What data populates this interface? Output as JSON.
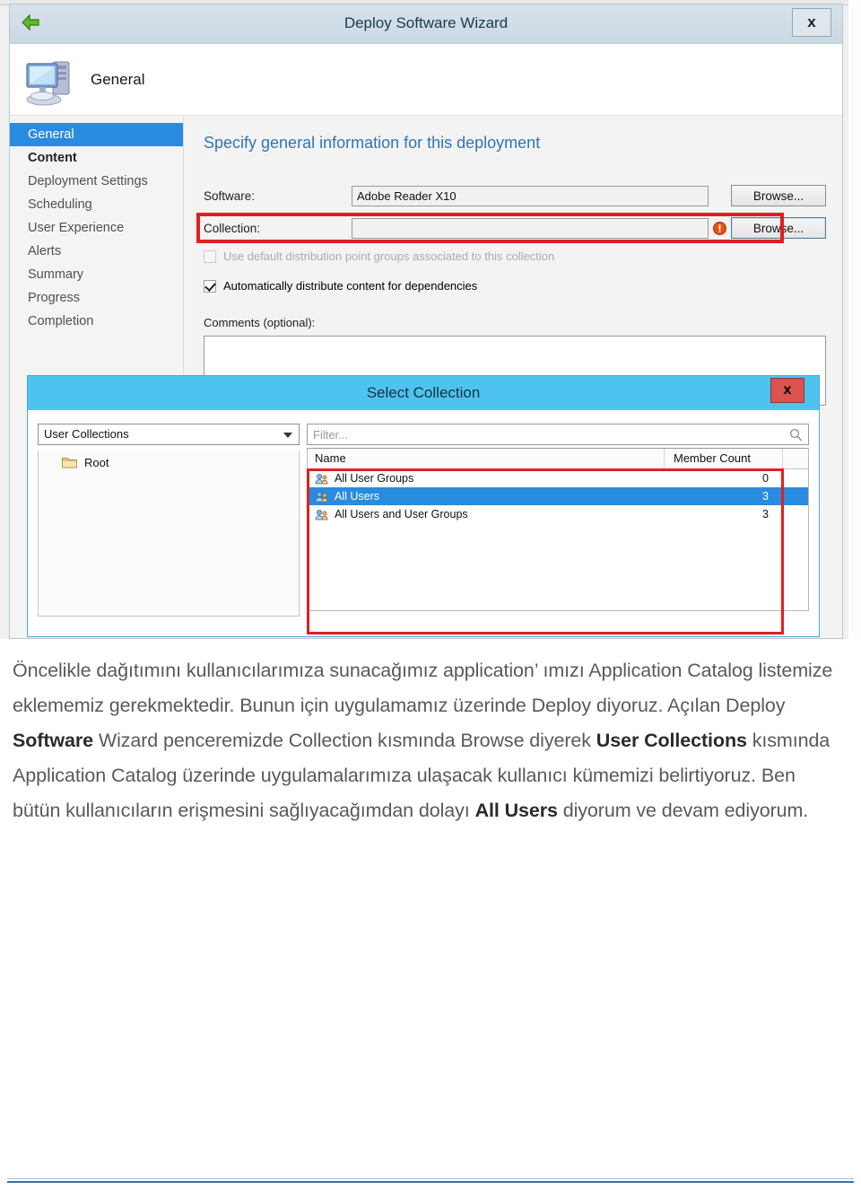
{
  "wizard": {
    "title": "Deploy Software Wizard",
    "close_label": "x",
    "header_label": "General",
    "content_heading": "Specify general information for this deployment",
    "icons": {
      "back_arrow": "green-arrow-icon",
      "computer": "computer-icon"
    },
    "sidebar": {
      "items": [
        {
          "label": "General",
          "state": "active"
        },
        {
          "label": "Content",
          "state": "visited"
        },
        {
          "label": "Deployment Settings",
          "state": "normal"
        },
        {
          "label": "Scheduling",
          "state": "normal"
        },
        {
          "label": "User Experience",
          "state": "normal"
        },
        {
          "label": "Alerts",
          "state": "normal"
        },
        {
          "label": "Summary",
          "state": "normal"
        },
        {
          "label": "Progress",
          "state": "normal"
        },
        {
          "label": "Completion",
          "state": "normal"
        }
      ]
    },
    "form": {
      "software_label": "Software:",
      "software_value": "Adobe Reader X10",
      "software_browse": "Browse...",
      "collection_label": "Collection:",
      "collection_value": "",
      "collection_browse": "Browse...",
      "collection_warning_icon": "warning-icon",
      "checkbox_default_dp": {
        "label": "Use default distribution point groups associated to this collection",
        "checked": false,
        "enabled": false
      },
      "checkbox_auto_distribute": {
        "label": "Automatically distribute content for dependencies",
        "checked": true,
        "enabled": true
      },
      "comments_label": "Comments (optional):",
      "comments_value": ""
    }
  },
  "modal": {
    "title": "Select Collection",
    "close_label": "x",
    "collection_type_selected": "User Collections",
    "tree_root_label": "Root",
    "filter_placeholder": "Filter...",
    "filter_value": "",
    "columns": [
      "Name",
      "Member Count"
    ],
    "rows": [
      {
        "name": "All User Groups",
        "count": "0",
        "selected": false
      },
      {
        "name": "All Users",
        "count": "3",
        "selected": true
      },
      {
        "name": "All Users and User Groups",
        "count": "3",
        "selected": false
      }
    ]
  },
  "caption": {
    "p1_a": "Öncelikle dağıtımını kullanıcılarımıza sunacağımız application’ ımızı Application Catalog listemize eklememiz gerekmektedir. Bunun için uygulamamız üzerinde Deploy diyoruz. Açılan Deploy ",
    "p1_b": "Software",
    "p1_c": " Wizard penceremizde Collection kısmında Browse diyerek ",
    "p1_d": "User Collections",
    "p1_e": " kısmında Application Catalog üzerinde uygulamalarımıza ulaşacak kullanıcı kümemizi belirtiyoruz. Ben bütün kullanıcıların erişmesini sağlıyacağımdan dolayı ",
    "p1_f": "All Users",
    "p1_g": " diyorum ve devam ediyorum."
  },
  "colors": {
    "accent_blue": "#2a8ce0",
    "modal_title_bar": "#4ec3ef",
    "highlight_red": "#e02020",
    "heading_blue": "#2e75b6",
    "close_red": "#d9534f"
  }
}
